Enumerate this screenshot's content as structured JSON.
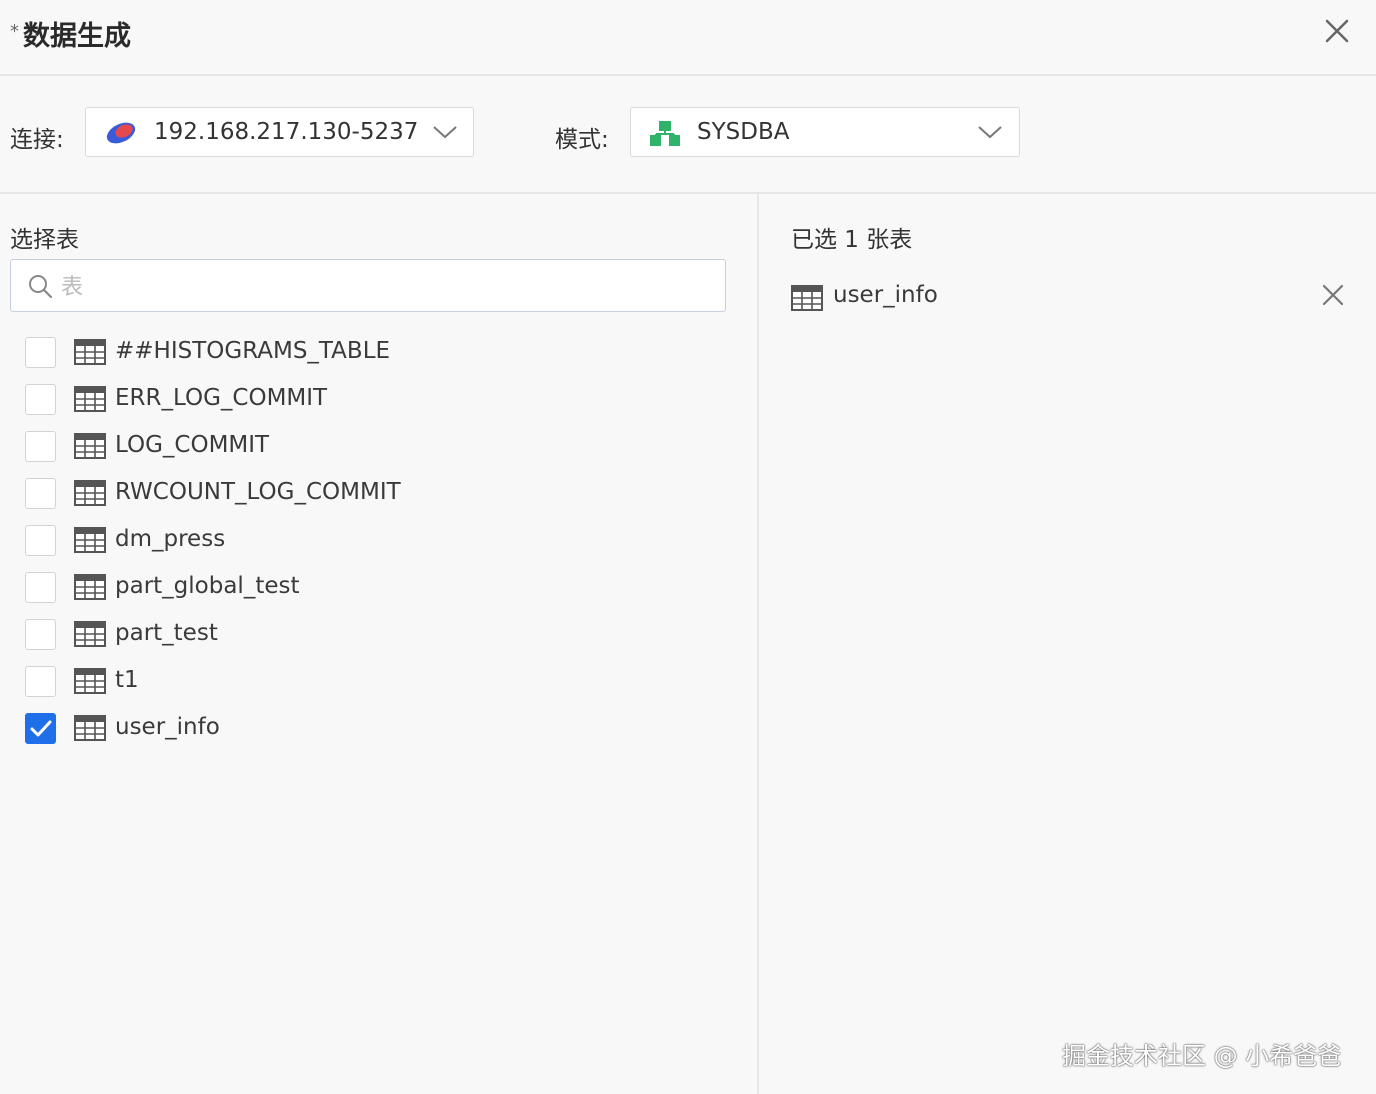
{
  "dialog": {
    "required_mark": "*",
    "title": "数据生成"
  },
  "connection": {
    "label": "连接:",
    "value": "192.168.217.130-5237"
  },
  "schema": {
    "label": "模式:",
    "value": "SYSDBA"
  },
  "left": {
    "section_title": "选择表",
    "search_placeholder": "表",
    "tables": [
      {
        "name": "##HISTOGRAMS_TABLE",
        "checked": false
      },
      {
        "name": "ERR_LOG_COMMIT",
        "checked": false
      },
      {
        "name": "LOG_COMMIT",
        "checked": false
      },
      {
        "name": "RWCOUNT_LOG_COMMIT",
        "checked": false
      },
      {
        "name": "dm_press",
        "checked": false
      },
      {
        "name": "part_global_test",
        "checked": false
      },
      {
        "name": "part_test",
        "checked": false
      },
      {
        "name": "t1",
        "checked": false
      },
      {
        "name": "user_info",
        "checked": true
      }
    ]
  },
  "right": {
    "section_title": "已选 1 张表",
    "selected": [
      {
        "name": "user_info"
      }
    ]
  },
  "watermark": "掘金技术社区 @ 小希爸爸",
  "colors": {
    "accent": "#1f6feb",
    "connection_icon_blue": "#3a5bd9",
    "connection_icon_red": "#e5484d",
    "schema_icon_green": "#2fb36b"
  }
}
